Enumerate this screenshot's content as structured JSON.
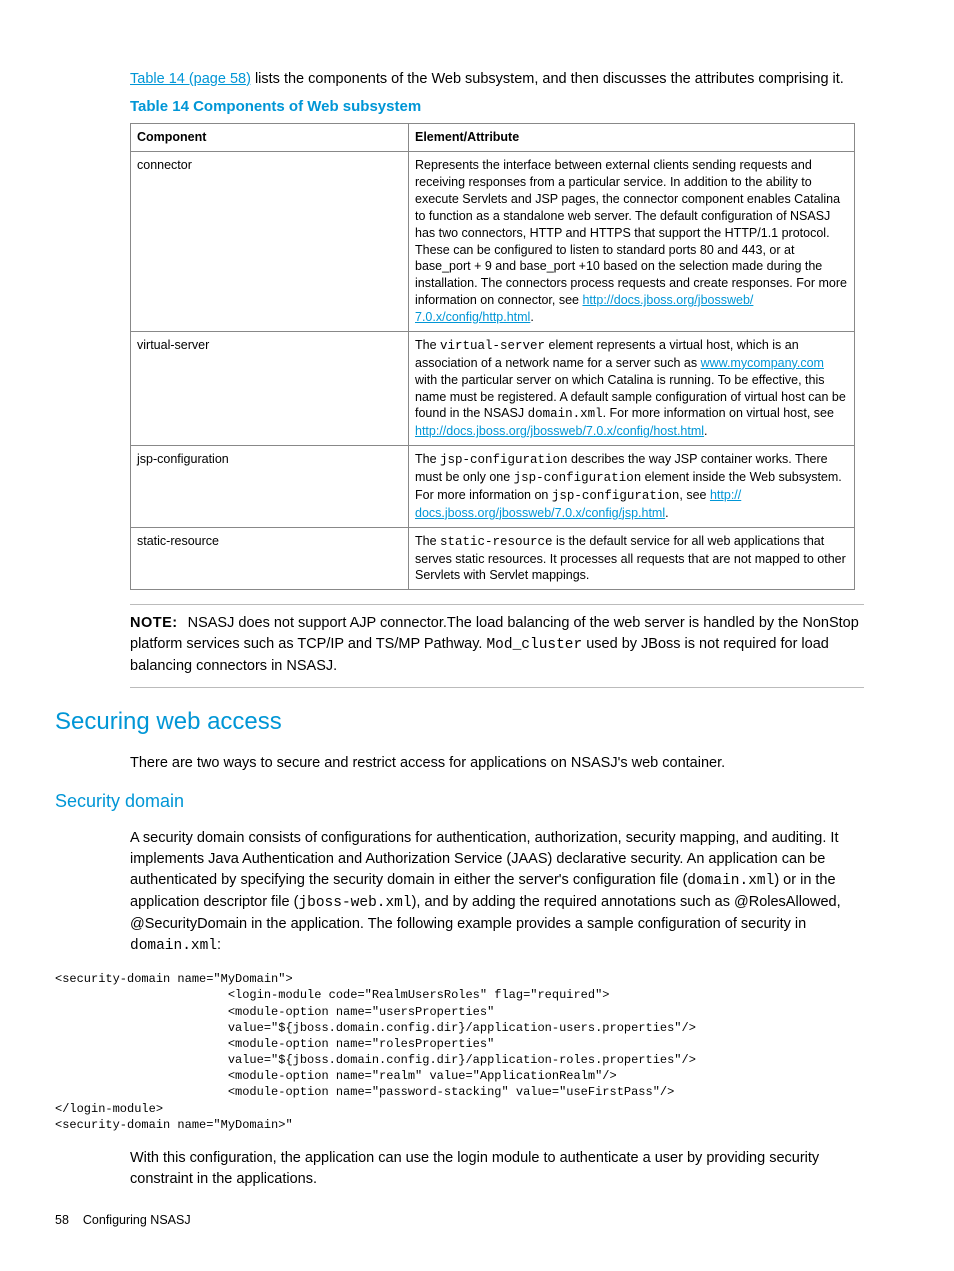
{
  "intro": {
    "link_text": "Table 14 (page 58)",
    "rest": " lists the components of the Web subsystem, and then discusses the attributes comprising it."
  },
  "table": {
    "caption": "Table 14 Components of Web subsystem",
    "headers": {
      "col1": "Component",
      "col2": "Element/Attribute"
    },
    "rows": {
      "connector": {
        "name": "connector",
        "desc_pre": "Represents the interface between external clients sending requests and receiving responses from a particular service. In addition to the ability to execute Servlets and JSP pages, the connector component enables Catalina to function as a standalone web server. The default configuration of NSASJ has two connectors, HTTP and HTTPS that support the HTTP/1.1 protocol. These can be configured to listen to standard ports 80 and 443, or at base_port + 9 and base_port +10 based on the selection made during the installation. The connectors process requests and create responses. For more information on connector, see ",
        "link1": "http://docs.jboss.org/jbossweb/",
        "link2": "7.0.x/config/http.html",
        "desc_post": "."
      },
      "virtual": {
        "name": "virtual-server",
        "t1": "The ",
        "code1": "virtual-server",
        "t2": " element represents a virtual host, which is an association of a network name for a server such as ",
        "link1": "www.mycompany.com",
        "t3": " with the particular server on which Catalina is running. To be effective, this name must be registered. A default sample configuration of virtual host can be found in the NSASJ ",
        "code2": "domain.xml",
        "t4": ". For more information on virtual host, see ",
        "link2": "http://docs.jboss.org/jbossweb/7.0.x/config/host.html",
        "t5": "."
      },
      "jsp": {
        "name": "jsp-configuration",
        "t1": "The ",
        "code1": "jsp-configuration",
        "t2": " describes the way JSP container works. There must be only one ",
        "code2": "jsp-configuration",
        "t3": " element inside the Web subsystem. For more information on ",
        "code3": "jsp-configuration",
        "t4": ", see ",
        "link1": "http://",
        "link2": "docs.jboss.org/jbossweb/7.0.x/config/jsp.html",
        "t5": "."
      },
      "static": {
        "name": "static-resource",
        "t1": "The ",
        "code1": "static-resource",
        "t2": " is the default service for all web applications that serves static resources. It processes all requests that are not mapped to other Servlets with Servlet mappings."
      }
    }
  },
  "note": {
    "label": "NOTE:",
    "t1": "NSASJ does not support AJP connector.The load balancing of the web server is handled by the NonStop platform services such as TCP/IP and TS/MP Pathway. ",
    "code1": "Mod_cluster",
    "t2": " used by JBoss is not required for load balancing connectors in NSASJ."
  },
  "h1": "Securing web access",
  "p_intro": "There are two ways to secure and restrict access for applications on NSASJ's web container.",
  "h2": "Security domain",
  "sd": {
    "t1": "A security domain consists of configurations for authentication, authorization, security mapping, and auditing. It implements Java Authentication and Authorization Service (JAAS) declarative security. An application can be authenticated by specifying the security domain in either the server's configuration file (",
    "code1": "domain.xml",
    "t2": ") or in the application descriptor file (",
    "code2": "jboss-web.xml",
    "t3": "), and by adding the required annotations such as @RolesAllowed, @SecurityDomain in the application. The following example provides a sample configuration of security in ",
    "code3": "domain.xml",
    "t4": ":"
  },
  "code_block": "<security-domain name=\"MyDomain\">\n                        <login-module code=\"RealmUsersRoles\" flag=\"required\">\n                        <module-option name=\"usersProperties\"\n                        value=\"${jboss.domain.config.dir}/application-users.properties\"/>\n                        <module-option name=\"rolesProperties\"\n                        value=\"${jboss.domain.config.dir}/application-roles.properties\"/>\n                        <module-option name=\"realm\" value=\"ApplicationRealm\"/>\n                        <module-option name=\"password-stacking\" value=\"useFirstPass\"/>\n</login-module>\n<security-domain name=\"MyDomain>\"",
  "p_after": "With this configuration, the application can use the login module to authenticate a user by providing security constraint in the applications.",
  "footer": {
    "page": "58",
    "title": "Configuring NSASJ"
  }
}
